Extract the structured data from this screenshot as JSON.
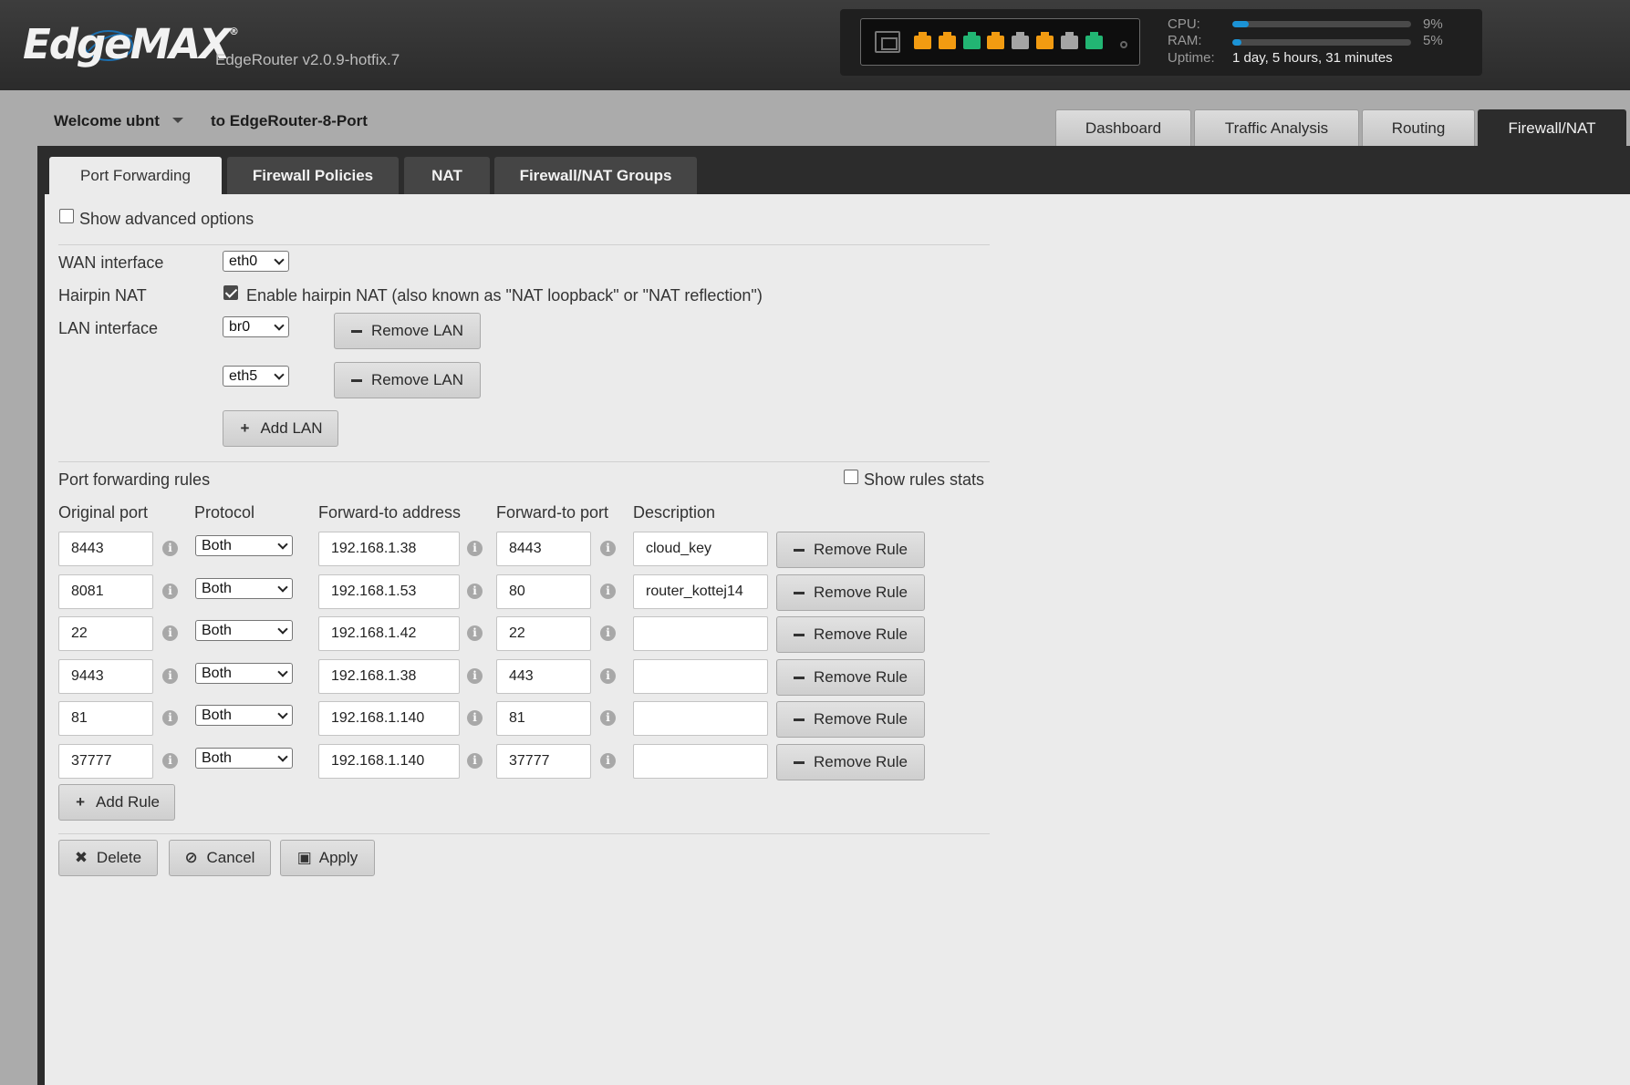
{
  "header": {
    "logo": "EdgeMAX",
    "logo_reg": "®",
    "version": "EdgeRouter v2.0.9-hotfix.7",
    "port_colors": [
      "#f29b11",
      "#f29b11",
      "#22b573",
      "#f29b11",
      "#a4a4a4",
      "#f29b11",
      "#a4a4a4",
      "#22b573"
    ],
    "cpu_label": "CPU:",
    "cpu_value": "9%",
    "cpu_fraction": 0.09,
    "ram_label": "RAM:",
    "ram_value": "5%",
    "ram_fraction": 0.05,
    "uptime_label": "Uptime:",
    "uptime_value": "1 day, 5 hours, 31 minutes"
  },
  "welcome": {
    "user": "Welcome ubnt",
    "device": "to EdgeRouter-8-Port"
  },
  "nav": {
    "tabs": [
      "Dashboard",
      "Traffic Analysis",
      "Routing",
      "Firewall/NAT"
    ],
    "active": "Firewall/NAT"
  },
  "subtabs": {
    "tabs": [
      "Port Forwarding",
      "Firewall Policies",
      "NAT",
      "Firewall/NAT Groups"
    ],
    "active": "Port Forwarding"
  },
  "form": {
    "advanced_label": "Show advanced options",
    "wan_label": "WAN interface",
    "wan_value": "eth0",
    "hairpin_label": "Hairpin NAT",
    "hairpin_text": "Enable hairpin NAT (also known as \"NAT loopback\" or \"NAT reflection\")",
    "lan_label": "LAN interface",
    "lans": [
      "br0",
      "eth5"
    ],
    "remove_lan": "Remove LAN",
    "add_lan": "Add LAN",
    "rules_title": "Port forwarding rules",
    "show_stats": "Show rules stats",
    "col_original": "Original port",
    "col_protocol": "Protocol",
    "col_address": "Forward-to address",
    "col_port": "Forward-to port",
    "col_description": "Description",
    "remove_rule": "Remove Rule",
    "add_rule": "Add Rule",
    "rules": [
      {
        "original": "8443",
        "protocol": "Both",
        "address": "192.168.1.38",
        "port": "8443",
        "description": "cloud_key"
      },
      {
        "original": "8081",
        "protocol": "Both",
        "address": "192.168.1.53",
        "port": "80",
        "description": "router_kottej14"
      },
      {
        "original": "22",
        "protocol": "Both",
        "address": "192.168.1.42",
        "port": "22",
        "description": ""
      },
      {
        "original": "9443",
        "protocol": "Both",
        "address": "192.168.1.38",
        "port": "443",
        "description": ""
      },
      {
        "original": "81",
        "protocol": "Both",
        "address": "192.168.1.140",
        "port": "81",
        "description": ""
      },
      {
        "original": "37777",
        "protocol": "Both",
        "address": "192.168.1.140",
        "port": "37777",
        "description": ""
      }
    ],
    "delete": "Delete",
    "cancel": "Cancel",
    "apply": "Apply"
  }
}
